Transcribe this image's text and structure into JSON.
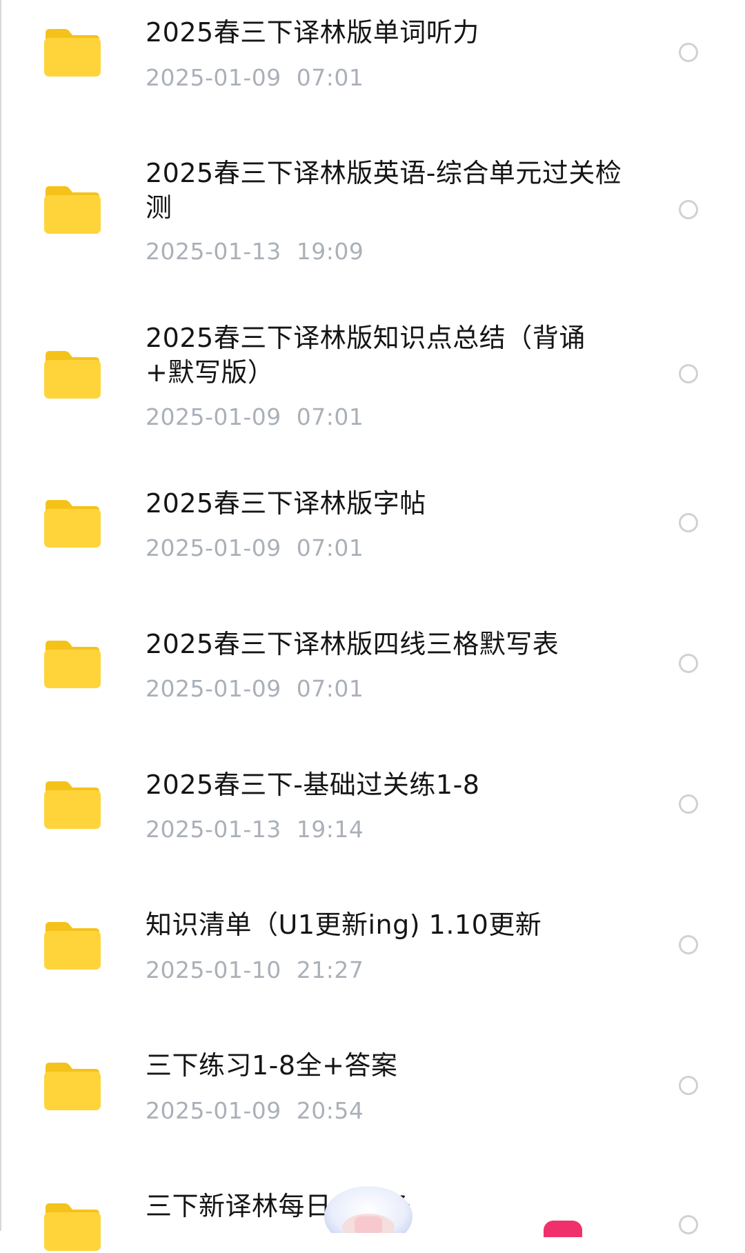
{
  "files": [
    {
      "name": "2025春三下译林版单词听力",
      "date": "2025-01-09  07:01",
      "icon": "folder-icon"
    },
    {
      "name": "2025春三下译林版英语-综合单元过关检测",
      "date": "2025-01-13  19:09",
      "icon": "folder-icon"
    },
    {
      "name": "2025春三下译林版知识点总结（背诵+默写版）",
      "date": "2025-01-09  07:01",
      "icon": "folder-icon"
    },
    {
      "name": "2025春三下译林版字帖",
      "date": "2025-01-09  07:01",
      "icon": "folder-icon"
    },
    {
      "name": "2025春三下译林版四线三格默写表",
      "date": "2025-01-09  07:01",
      "icon": "folder-icon"
    },
    {
      "name": "2025春三下-基础过关练1-8",
      "date": "2025-01-13  19:14",
      "icon": "folder-icon"
    },
    {
      "name": "知识清单（U1更新ing) 1.10更新",
      "date": "2025-01-10  21:27",
      "icon": "folder-icon"
    },
    {
      "name": "三下练习1-8全+答案",
      "date": "2025-01-09  20:54",
      "icon": "folder-icon"
    },
    {
      "name": "三下新译林每日小纸条",
      "date": "",
      "icon": "folder-icon"
    }
  ],
  "colors": {
    "folder": "#ffd43b",
    "folder_tab": "#f5c21a",
    "title_text": "#151515",
    "date_text": "#aab0b8",
    "radio_border": "#cfd1d4"
  }
}
